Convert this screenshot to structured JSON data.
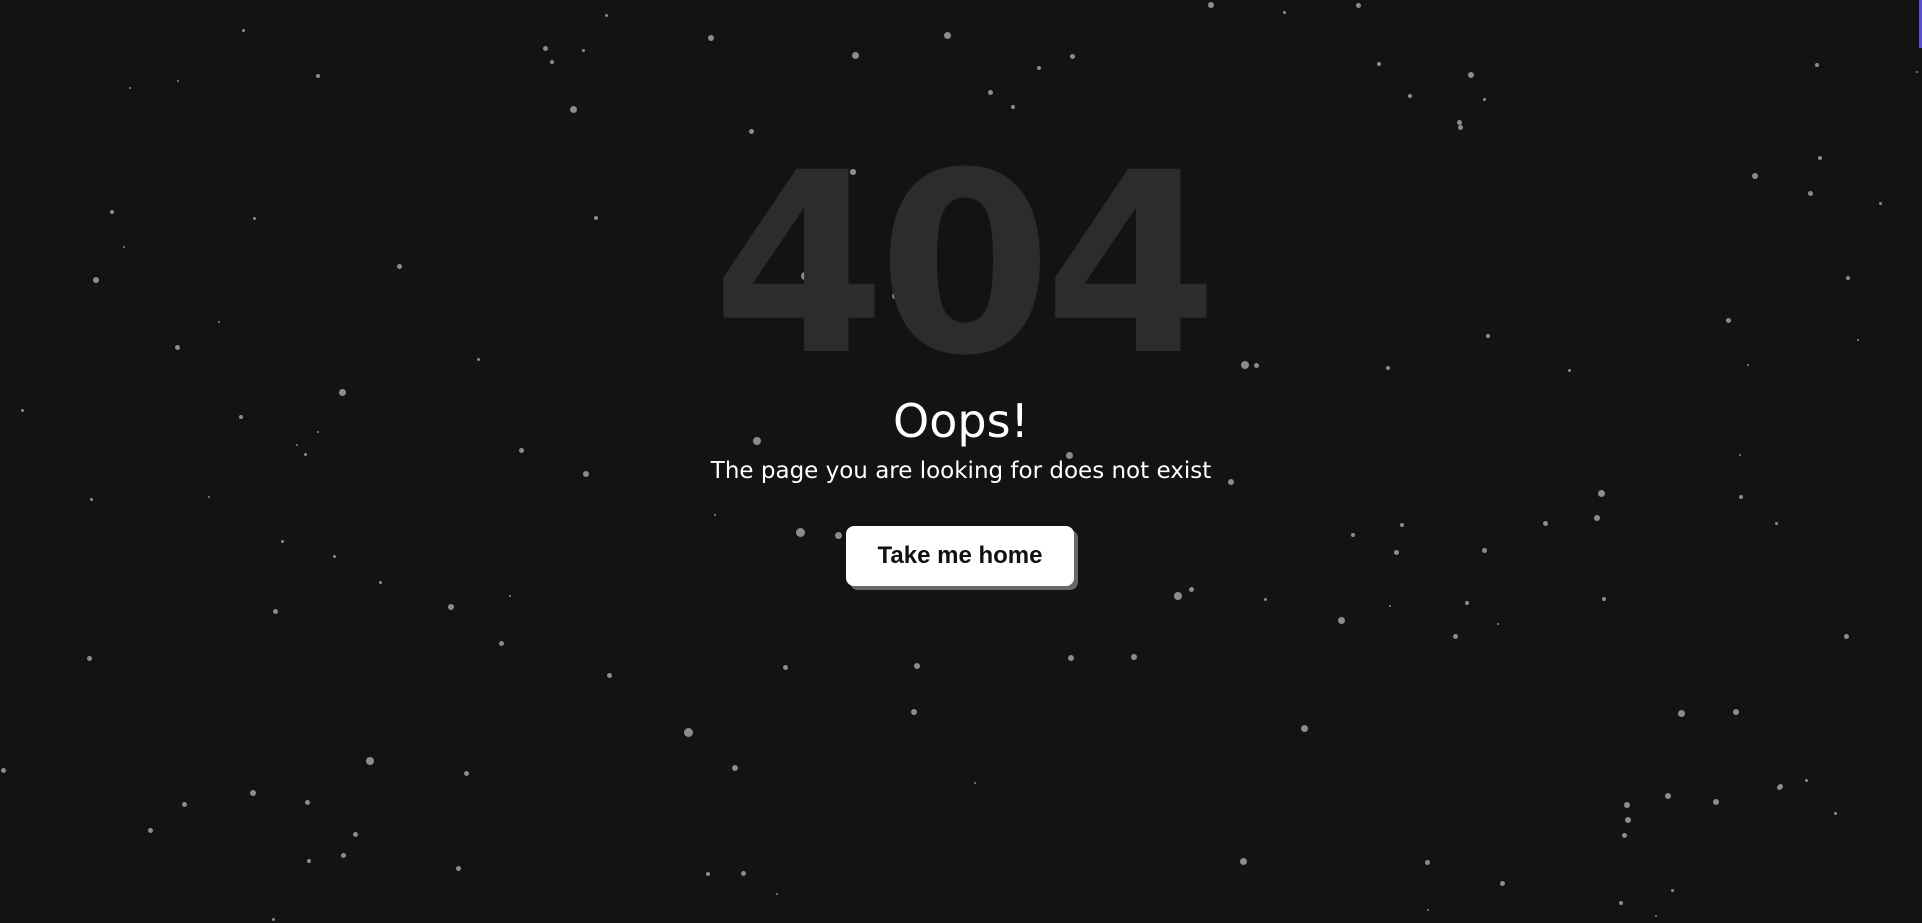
{
  "error": {
    "code": "404",
    "title": "Oops!",
    "message": "The page you are looking for does not exist"
  },
  "actions": {
    "home_label": "Take me home"
  },
  "colors": {
    "background": "#131313",
    "code_text": "#2c2c2c",
    "star": "#8c8c8c",
    "button_bg": "#ffffff",
    "button_shadow": "#6a6a6a"
  }
}
